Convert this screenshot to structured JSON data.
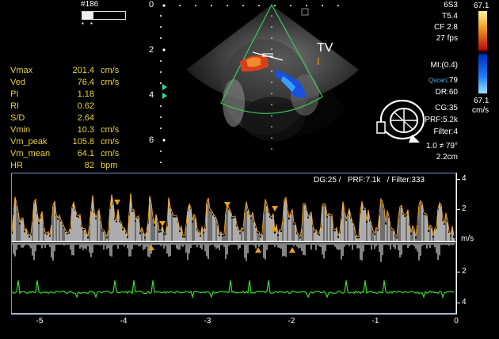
{
  "header": {
    "frame_number": "#186"
  },
  "depth_scale": [
    "0",
    "2",
    "4",
    "6"
  ],
  "labels": {
    "valve": "TV",
    "marker": "I"
  },
  "measurements": [
    {
      "name": "Vmax",
      "value": "201.4",
      "unit": "cm/s"
    },
    {
      "name": "Ved",
      "value": "76.4",
      "unit": "cm/s"
    },
    {
      "name": "PI",
      "value": "1.18",
      "unit": ""
    },
    {
      "name": "RI",
      "value": "0.62",
      "unit": ""
    },
    {
      "name": "S/D",
      "value": "2.64",
      "unit": ""
    },
    {
      "name": "Vmin",
      "value": "10.3",
      "unit": "cm/s"
    },
    {
      "name": "Vm_peak",
      "value": "105.8",
      "unit": "cm/s"
    },
    {
      "name": "Vm_mean",
      "value": "64.1",
      "unit": "cm/s"
    },
    {
      "name": "HR",
      "value": "82",
      "unit": "bpm"
    }
  ],
  "probe": {
    "model": "6S3",
    "t": "T5.4",
    "cf": "CF 2.8",
    "fps": "27 fps"
  },
  "color_scale": {
    "top": "67.1",
    "bottom": "67.1",
    "unit": "cm/s"
  },
  "image_params": {
    "mi": "MI:(0.4)",
    "qscan_label": "Qscan",
    "qscan_value": ":79",
    "dr": "DR:60",
    "cg": "CG:35",
    "prf": "PRF:5.2k",
    "filter": "Filter:4",
    "angle": "1.0 ≠ 79°",
    "gate": "2.2cm"
  },
  "doppler": {
    "header": "DG:25 /   PRF:7.1k   / Filter:333",
    "velocity_unit": "m/s",
    "velocity_ticks": [
      "4",
      "2",
      "2",
      "4"
    ],
    "time_ticks": [
      "-5",
      "-4",
      "-3",
      "-2",
      "-1",
      "0"
    ]
  },
  "colors": {
    "measurement": "#e8d23a",
    "trace": "#e89a1a",
    "ecg": "#3adc2a",
    "frame": "#6f8fd0",
    "sector": "#3acb5a"
  }
}
